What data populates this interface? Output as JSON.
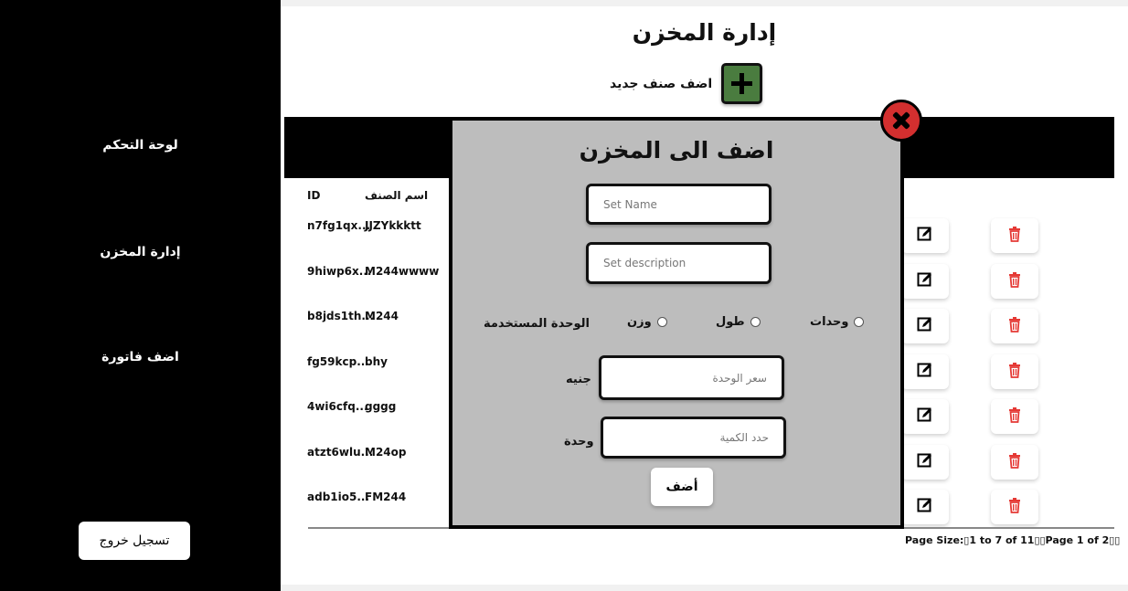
{
  "sidebar": {
    "items": [
      {
        "label": "لوحة التحكم"
      },
      {
        "label": "إدارة المخزن"
      },
      {
        "label": "اضف فاتورة"
      }
    ],
    "logout_label": "تسجيل خروج"
  },
  "header": {
    "title": "إدارة المخزن",
    "add_item_label": "اضف صنف جديد"
  },
  "table": {
    "columns": {
      "id": "ID",
      "name": "اسم الصنف"
    },
    "rows": [
      {
        "id": "n7fg1qx...",
        "name": "JJZYkkktt"
      },
      {
        "id": "9hiwp6x...",
        "name": "M244wwww"
      },
      {
        "id": "b8jds1th...",
        "name": "M244"
      },
      {
        "id": "fg59kcp...",
        "name": "bhy"
      },
      {
        "id": "4wi6cfq...",
        "name": "gggg"
      },
      {
        "id": "atzt6wlu...",
        "name": "M24op"
      },
      {
        "id": "adb1io5...",
        "name": "FM244"
      }
    ],
    "edit_icon": "edit-icon",
    "delete_icon": "trash-icon",
    "delete_color": "#e53935"
  },
  "pagination": {
    "text": "Page Size:▯1 to 7 of 11▯▯Page 1 of 2▯▯"
  },
  "modal": {
    "title": "اضف الى المخزن",
    "name_placeholder": "Set Name",
    "description_placeholder": "Set description",
    "unit_label": "الوحدة المستخدمة",
    "unit_options": [
      "وزن",
      "طول",
      "وحدات"
    ],
    "price_placeholder": "سعر الوحدة",
    "price_unit": "جنيه",
    "quantity_placeholder": "حدد الكمية",
    "quantity_unit": "وحدة",
    "submit_label": "أضف",
    "close_color": "#d32f2f"
  },
  "colors": {
    "accent_green": "#4a7c3f",
    "sidebar_bg": "#000000",
    "modal_bg": "#bdbdbd"
  }
}
